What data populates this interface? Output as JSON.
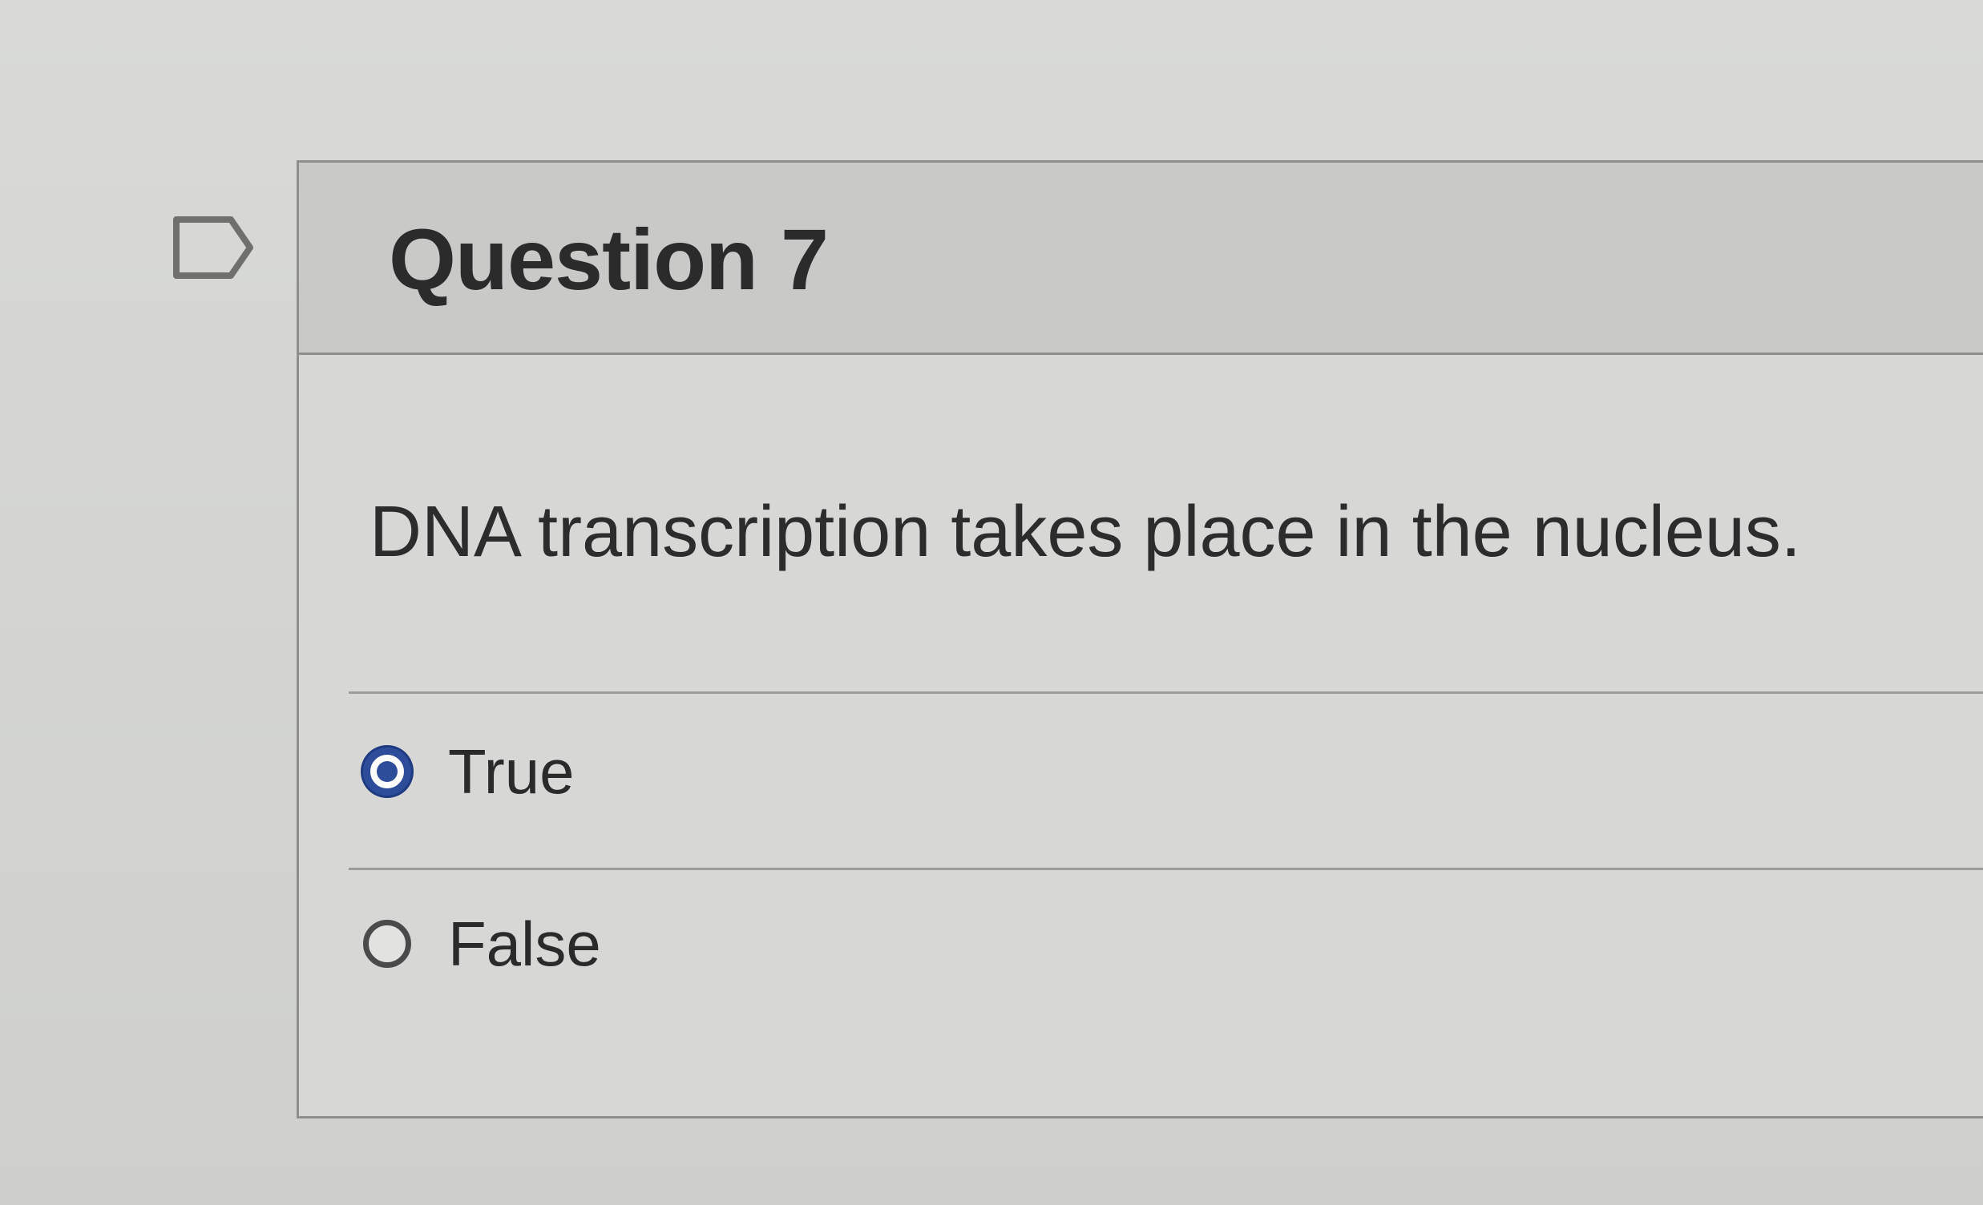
{
  "question": {
    "title": "Question 7",
    "text": "DNA transcription takes place in the nucleus.",
    "flag_icon": "flag-outline-icon"
  },
  "answers": [
    {
      "label": "True",
      "selected": true
    },
    {
      "label": "False",
      "selected": false
    }
  ],
  "colors": {
    "background": "#d6d7d5",
    "header": "#c9cac8",
    "radio_selected": "#2d4d9a",
    "text": "#2b2b2b"
  }
}
